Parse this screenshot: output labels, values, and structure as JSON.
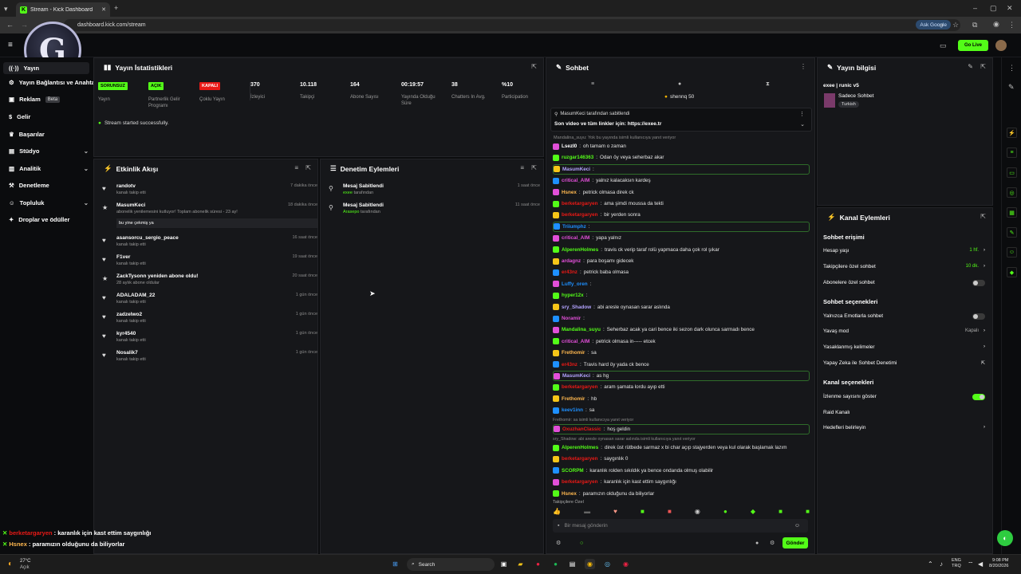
{
  "browser": {
    "tab_title": "Stream - Kick Dashboard",
    "url": "dashboard.kick.com/stream",
    "ask_google": "Ask Google"
  },
  "topnav": {
    "go_live": "Go Live"
  },
  "sidebar": {
    "items": [
      {
        "label": "Yayın"
      },
      {
        "label": "Yayın Bağlantısı ve Anahtarı"
      },
      {
        "label": "Reklam",
        "badge": "Beta"
      },
      {
        "label": "Gelir"
      },
      {
        "label": "Başarılar"
      },
      {
        "label": "Stüdyo"
      },
      {
        "label": "Analitik"
      },
      {
        "label": "Denetleme"
      },
      {
        "label": "Topluluk"
      },
      {
        "label": "Droplar ve ödüller"
      }
    ]
  },
  "stats": {
    "title": "Yayın İstatistikleri",
    "items": [
      {
        "value": "SORUNSUZ",
        "label": "Yayın",
        "badge_color": "#53fc18"
      },
      {
        "value": "AÇIK",
        "label": "Partnerlik Gelir Programı",
        "badge_color": "#53fc18"
      },
      {
        "value": "KAPALI",
        "label": "Çoklu Yayın",
        "badge_color": "#e91916"
      },
      {
        "value": "370",
        "label": "İzleyici"
      },
      {
        "value": "10.118",
        "label": "Takipçi"
      },
      {
        "value": "164",
        "label": "Abone Sayısı"
      },
      {
        "value": "00:19:57",
        "label": "Yayında Olduğu Süre"
      },
      {
        "value": "38",
        "label": "Chatters In Avg."
      },
      {
        "value": "%10",
        "label": "Participation"
      }
    ],
    "success": "Stream started successfully."
  },
  "activity": {
    "title": "Etkinlik Akışı",
    "events": [
      {
        "name": "randotv",
        "sub": "kanalı takip etti",
        "time": "7 dakika önce",
        "icon": "heart"
      },
      {
        "name": "MasumKeci",
        "sub": "abonelik yenilemesini kutluyor! Toplam abonelik süresi - 23 ay!",
        "msg": "bu yine çekmiş ya",
        "time": "18 dakika önce",
        "icon": "star"
      },
      {
        "name": "asansorcu_sergio_peace",
        "sub": "kanalı takip etti",
        "time": "16 saat önce",
        "icon": "heart"
      },
      {
        "name": "F1ver",
        "sub": "kanalı takip etti",
        "time": "19 saat önce",
        "icon": "heart"
      },
      {
        "name": "ZackTysonn yeniden abone oldu!",
        "sub": "28 aylık abone oldular",
        "time": "20 saat önce",
        "icon": "star"
      },
      {
        "name": "ADALADAM_22",
        "sub": "kanalı takip etti",
        "time": "1 gün önce",
        "icon": "heart"
      },
      {
        "name": "zadzelwo2",
        "sub": "kanalı takip etti",
        "time": "1 gün önce",
        "icon": "heart"
      },
      {
        "name": "kyr4540",
        "sub": "kanalı takip etti",
        "time": "1 gün önce",
        "icon": "heart"
      },
      {
        "name": "Nosalik7",
        "sub": "kanalı takip etti",
        "time": "1 gün önce",
        "icon": "heart"
      }
    ]
  },
  "moderation": {
    "title": "Denetim Eylemleri",
    "items": [
      {
        "name": "Mesaj Sabitlendi",
        "by": "exee",
        "by_suffix": " tarafından",
        "time": "1 saat önce"
      },
      {
        "name": "Mesaj Sabitlendi",
        "by": "Arasepo",
        "by_suffix": " tarafından",
        "time": "11 saat önce"
      }
    ]
  },
  "chat": {
    "title": "Sohbet",
    "goal": "shennq 50",
    "pinned_by": "MasumKeci tarafından sabitlendi",
    "pinned_text": "Son video ve tüm linkler için: https://exee.tr",
    "input_placeholder": "Bir mesaj gönderin",
    "send": "Gönder",
    "followers_only": "Takipçilere Özel",
    "reply_note1": "Mandalina_suyu: Yok bu yayında isimli kullanıcıya yanıt veriyor",
    "messages": [
      {
        "user": "LsezI0",
        "color": "#ffffff",
        "text": "oh tamam o zaman"
      },
      {
        "user": "ruzgar146363",
        "color": "#53fc18",
        "text": "Odan öy veya seherbaz akar"
      },
      {
        "user": "MasumKeci",
        "color": "#b3a3ff",
        "text": "",
        "hl": true
      },
      {
        "user": "critical_AIM",
        "color": "#e14fd8",
        "text": "yalnız kalacaksın kardeş"
      },
      {
        "user": "Hsnex",
        "color": "#ffb84f",
        "text": "petrick olmasa direk ck"
      },
      {
        "user": "berketargaryen",
        "color": "#e91916",
        "text": "ama şimdi moussa da tekti"
      },
      {
        "user": "berketargaryen",
        "color": "#e91916",
        "text": "bir yerden sonra"
      },
      {
        "user": "Triiumphz",
        "color": "#1e90ff",
        "text": "",
        "hl": true
      },
      {
        "user": "critical_AIM",
        "color": "#e14fd8",
        "text": "yapa yalnız"
      },
      {
        "user": "AlperenHolmes",
        "color": "#53fc18",
        "text": "travis ck verip taraf rolü yapmaca daha çok rol şıkar"
      },
      {
        "user": "ardagnz",
        "color": "#e14fd8",
        "text": "para boşamı gidecek"
      },
      {
        "user": "er43nz",
        "color": "#e91916",
        "text": "petrick baba olmasa"
      },
      {
        "user": "Luffy_oren",
        "color": "#1e90ff",
        "text": ""
      },
      {
        "user": "hyper12x",
        "color": "#53fc18",
        "text": ""
      },
      {
        "user": "sry_Shadow",
        "color": "#b3a3ff",
        "text": "abi aresle oynasan sarar aslında"
      },
      {
        "user": "Noramir",
        "color": "#e14fd8",
        "text": ""
      },
      {
        "user": "Mandalina_suyu",
        "color": "#53fc18",
        "text": "Seherbaz acak ya cari bence iki sezon dark olunca sarmadı bence"
      },
      {
        "user": "critical_AIM",
        "color": "#e14fd8",
        "text": "petrick olmasa in----- etcek"
      },
      {
        "user": "Frethomir",
        "color": "#ffb84f",
        "text": "sa"
      },
      {
        "user": "er43nz",
        "color": "#e91916",
        "text": "Travis hard öy yada ck bence"
      },
      {
        "user": "MasumKeci",
        "color": "#b3a3ff",
        "text": "as hg",
        "hl": true
      },
      {
        "user": "berketargaryen",
        "color": "#e91916",
        "text": "aram şamata lordu ayıp etti"
      },
      {
        "user": "Frethomir",
        "color": "#ffb84f",
        "text": "hb"
      },
      {
        "user": "keev1inn",
        "color": "#1e90ff",
        "text": "sa"
      },
      {
        "user": "OxuzhanClassic",
        "color": "#e91916",
        "text": "hoş geldin",
        "hl": true,
        "reply": "Frethomir: sa isimli kullanıcıya yanıt veriyor"
      },
      {
        "user": "AlperenHolmes",
        "color": "#53fc18",
        "text": "direk üst rütbede sarmaz x bi char açıp stajyerden veya kul olarak başlamak lazım",
        "reply": "sry_Shadow: abi aresle oynasan sarar aslında isimli kullanıcıya yanıt veriyor"
      },
      {
        "user": "berketargaryen",
        "color": "#e91916",
        "text": "saygınlık 0"
      },
      {
        "user": "SCORPM",
        "color": "#53fc18",
        "text": "karanlık rolden sıkıldık ya bence ondanda olmuş olabilir"
      },
      {
        "user": "berketargaryen",
        "color": "#e91916",
        "text": "karanlık için kast ettim saygınlığı"
      },
      {
        "user": "Hsnex",
        "color": "#ffb84f",
        "text": "paramızın olduğunu da biliyorlar"
      }
    ]
  },
  "stream_info": {
    "title": "Yayın bilgisi",
    "stream_title": "exee | runic v5",
    "category": "Sadece Sohbet",
    "tag": "Turkish"
  },
  "channel_actions": {
    "title": "Kanal Eylemleri",
    "chat_access": "Sohbet erişimi",
    "rows1": [
      {
        "label": "Hesap yaşı",
        "value": "1 hf."
      },
      {
        "label": "Takipçilere özel sohbet",
        "value": "10 dk."
      },
      {
        "label": "Abonelere özel sohbet",
        "value": ""
      }
    ],
    "chat_options": "Sohbet seçenekleri",
    "rows2": [
      {
        "label": "Yalnızca Emotlarla sohbet",
        "value": ""
      },
      {
        "label": "Yavaş mod",
        "value": "Kapalı"
      },
      {
        "label": "Yasaklanmış kelimeler",
        "value": ""
      },
      {
        "label": "Yapay Zeka ile Sohbet Denetimi",
        "value": ""
      }
    ],
    "channel_options": "Kanal seçenekleri",
    "rows3": [
      {
        "label": "İzlenme sayısını göster",
        "value": ""
      },
      {
        "label": "Raid Kanalı",
        "value": ""
      },
      {
        "label": "Hedefleri belirleyin",
        "value": ""
      }
    ]
  },
  "overlay": {
    "lines": [
      {
        "user": "berketargaryen",
        "color": "#e91916",
        "text": " : karanlık için kast ettim saygınlığı"
      },
      {
        "user": "Hsnex",
        "color": "#ffb84f",
        "text": " : paramızın olduğunu da biliyorlar"
      }
    ]
  },
  "taskbar": {
    "temp": "27°C",
    "weather": "Açık",
    "search": "Search",
    "lang1": "ENG",
    "lang2": "TRQ",
    "time": "9:08 PM",
    "date": "8/20/2026"
  },
  "colors": {
    "accent": "#53fc18",
    "panel": "#16171a",
    "bg": "#0b0c0e"
  }
}
